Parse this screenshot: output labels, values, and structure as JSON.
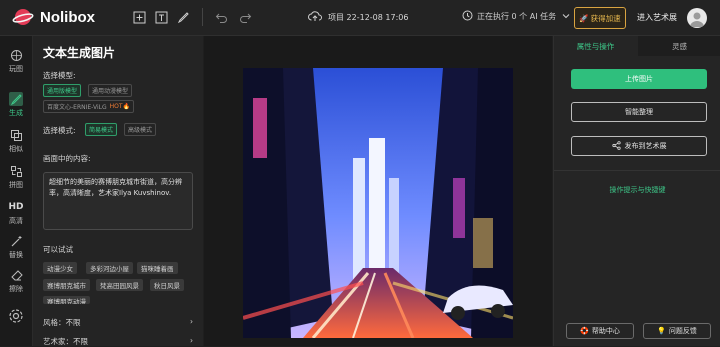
{
  "header": {
    "logo_text": "Nolibox",
    "project_label": "项目 22-12-08 17:06",
    "running_tasks": "正在执行 0 个 AI 任务",
    "boost_label": "获得加速",
    "gallery_link": "进入艺术展"
  },
  "sidebar": {
    "items": [
      {
        "label": "玩图",
        "icon": "layers-icon"
      },
      {
        "label": "生成",
        "icon": "brush-icon",
        "active": true
      },
      {
        "label": "相似",
        "icon": "copy-icon"
      },
      {
        "label": "拼图",
        "icon": "puzzle-icon"
      },
      {
        "label": "高清",
        "icon": "hd-icon"
      },
      {
        "label": "替换",
        "icon": "magic-wand-icon"
      },
      {
        "label": "擦除",
        "icon": "eraser-icon"
      }
    ]
  },
  "panel": {
    "title": "文本生成图片",
    "model_label": "选择模型:",
    "models": [
      "通用版模型",
      "通用动漫模型",
      "百度文心-ERNIE-ViLG"
    ],
    "hot_badge": "HOT🔥",
    "mode_label": "选择模式:",
    "modes": [
      "简易模式",
      "高级模式"
    ],
    "prompt_label": "画面中的内容:",
    "prompt_text": "超细节的美丽的赛博朋克城市街道，高分辨率，高清晰度，艺术家Ilya Kuvshinov.",
    "try_label": "可以试试",
    "try_chips": [
      "动漫少女",
      "多彩河边小屋",
      "猫咪睡着画",
      "赛博朋克城市",
      "梵高田园风景",
      "秋日风景",
      "赛博朋克动漫"
    ],
    "style_label": "风格：不限",
    "artist_label": "艺术家：不限"
  },
  "right_panel": {
    "tabs": [
      "属性与操作",
      "灵感"
    ],
    "upload_button": "上传图片",
    "smart_button": "智能整理",
    "publish_button": "发布到艺术展",
    "hint_link": "操作提示与快捷键",
    "help_button": "帮助中心",
    "feedback_button": "问题反馈"
  },
  "colors": {
    "accent": "#2fbf7d",
    "hot": "#f07b34",
    "boost": "#e8b84e"
  }
}
